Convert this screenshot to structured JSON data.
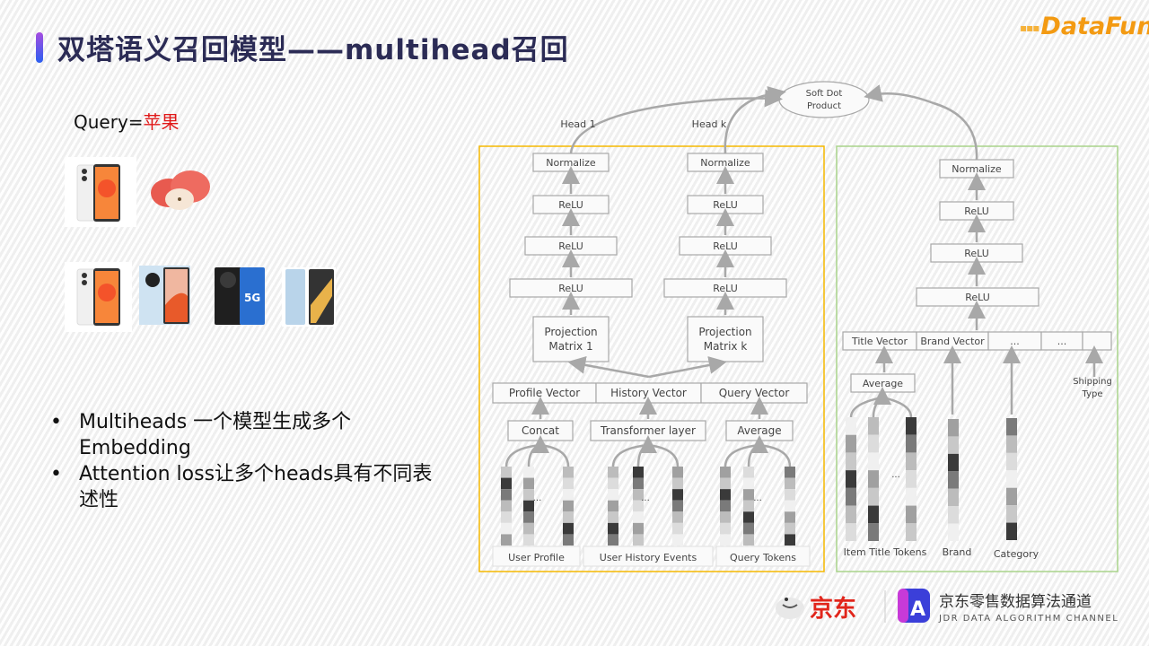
{
  "header": {
    "title": "双塔语义召回模型——multihead召回",
    "logo_text": "DataFun.",
    "accent_colors": {
      "title": "#2b2b55",
      "bar_top": "#a64de0",
      "bar_bottom": "#2a5ff0",
      "logo": "#f39a12"
    }
  },
  "left": {
    "query_prefix": "Query=",
    "query_value": "苹果",
    "query_value_color": "#e01818",
    "row1_images": [
      "iphone-image",
      "apple-fruit-image"
    ],
    "row2_images": [
      "iphone-image",
      "xiaomi-phone-image",
      "huawei-5g-phone-image",
      "vivo-phone-image"
    ],
    "bullets": [
      "Multiheads 一个模型生成多个Embedding",
      "Attention loss让多个heads具有不同表述性"
    ]
  },
  "diagram": {
    "output_node": "Soft Dot Product",
    "head_labels": [
      "Head 1",
      "Head k"
    ],
    "user_tower": {
      "border_color": "#f5b800",
      "head1": [
        "Normalize",
        "ReLU",
        "ReLU",
        "ReLU",
        "Projection Matrix 1"
      ],
      "headk": [
        "Normalize",
        "ReLU",
        "ReLU",
        "ReLU",
        "Projection Matrix k"
      ],
      "concat_vectors": [
        "Profile Vector",
        "History Vector",
        "Query Vector"
      ],
      "aggregators": [
        "Concat",
        "Transformer layer",
        "Average"
      ],
      "inputs": [
        "User Profile",
        "User History Events",
        "Query Tokens"
      ],
      "ellipsis": "..."
    },
    "item_tower": {
      "border_color": "#a8d48a",
      "layers": [
        "Normalize",
        "ReLU",
        "ReLU",
        "ReLU"
      ],
      "concat_vectors": [
        "Title Vector",
        "Brand Vector",
        "...",
        "...",
        ""
      ],
      "aggregator": "Average",
      "inputs": [
        "Item Title Tokens",
        "Brand",
        "Category",
        "Shipping Type"
      ],
      "ellipsis": "..."
    }
  },
  "footer": {
    "jd_text": "京东",
    "channel_title": "京东零售数据算法通道",
    "channel_subtitle": "JDR DATA ALGORITHM CHANNEL",
    "jd_color": "#e1251b"
  }
}
